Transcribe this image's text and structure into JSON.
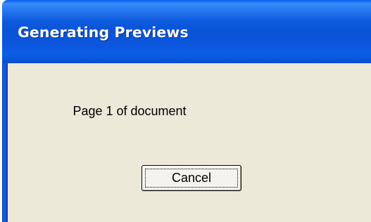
{
  "window": {
    "title": "Generating Previews"
  },
  "dialog": {
    "message": "Page 1 of document",
    "cancel_label": "Cancel"
  },
  "colors": {
    "titlebar": "#0a53d6",
    "client_background": "#ece9d8",
    "title_text": "#ffffff"
  }
}
